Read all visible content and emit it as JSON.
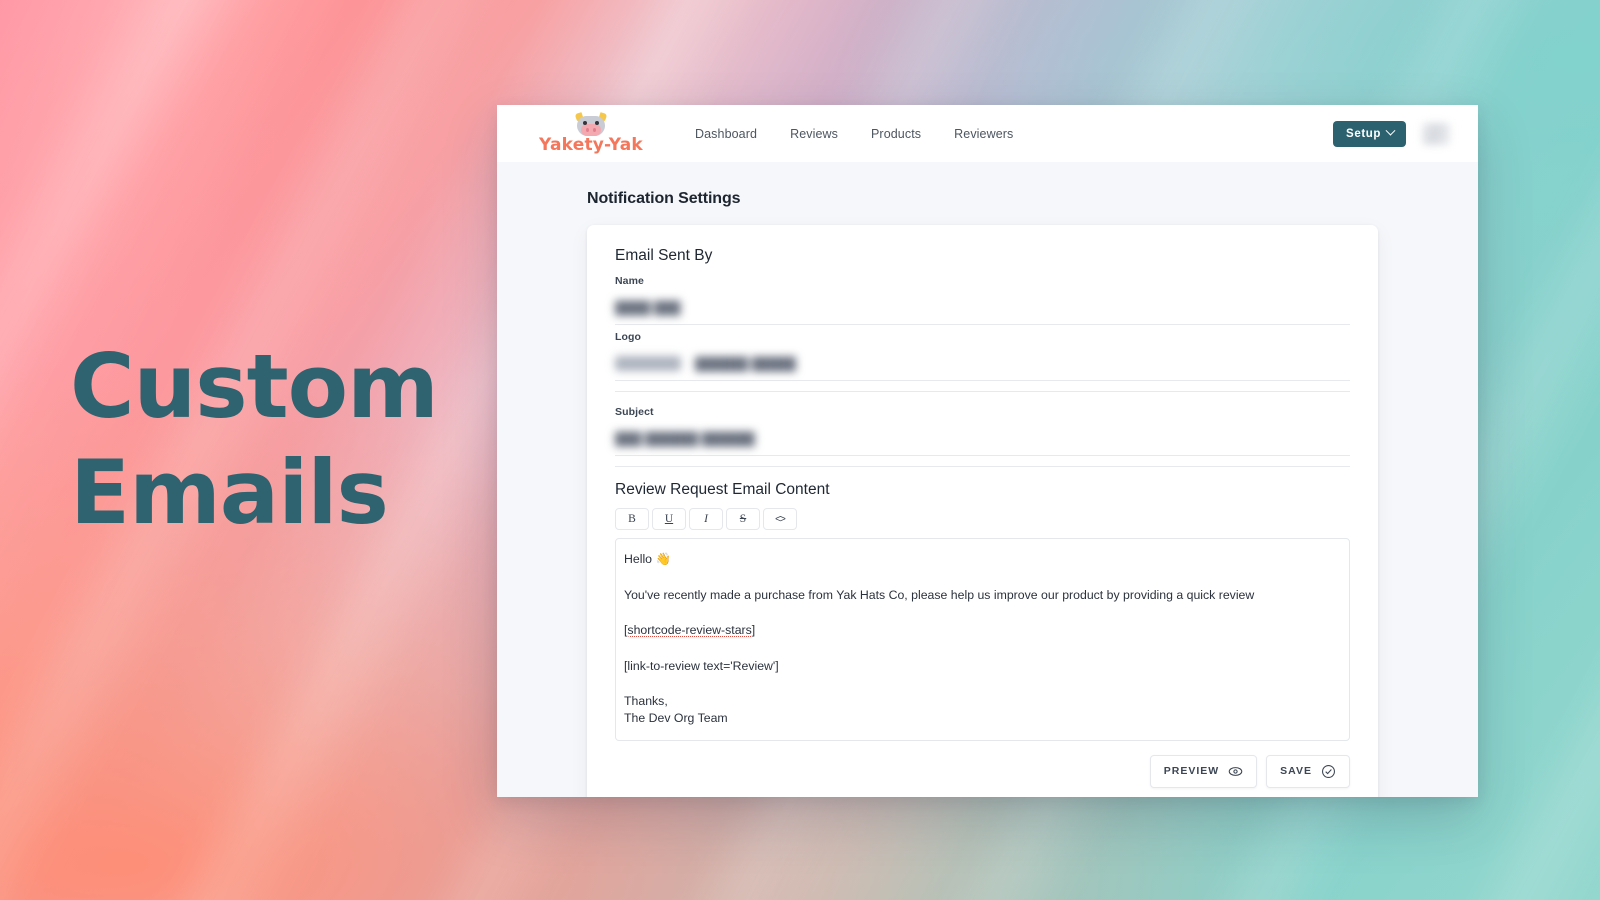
{
  "poster": {
    "headline": "Custom\nEmails",
    "headline_color": "#2e636f",
    "background_colors": [
      "#ff99a6",
      "#ff8f83",
      "#c3b9d4",
      "#8cd0cb",
      "#fb9181"
    ]
  },
  "app": {
    "brand": {
      "name": "Yakety-Yak",
      "name_color": "#f4775c",
      "logo_icon": "yak-face-icon"
    },
    "nav": [
      {
        "label": "Dashboard"
      },
      {
        "label": "Reviews"
      },
      {
        "label": "Products"
      },
      {
        "label": "Reviewers"
      }
    ],
    "header_actions": {
      "setup_label": "Setup",
      "setup_color": "#2c6270",
      "setup_chevron_icon": "chevron-down-icon",
      "avatar_icon": "avatar-blurred"
    },
    "page_title": "Notification Settings",
    "email_sent_by": {
      "section_title": "Email Sent By",
      "fields": [
        {
          "label": "Name",
          "value": "████ ███",
          "redacted": true
        },
        {
          "label": "Logo",
          "value": "██████ █████",
          "redacted": true
        },
        {
          "label": "Subject",
          "value": "███ ██████ ██████",
          "redacted": true
        }
      ]
    },
    "editor": {
      "title": "Review Request Email Content",
      "toolbar": [
        {
          "label": "B",
          "name": "bold-button"
        },
        {
          "label": "U",
          "name": "underline-button"
        },
        {
          "label": "I",
          "name": "italic-button"
        },
        {
          "label": "S",
          "name": "strikethrough-button"
        },
        {
          "label": "<>",
          "name": "code-button"
        }
      ],
      "body": {
        "greeting": "Hello 👋",
        "intro": "You've recently made a purchase from Yak Hats Co, please help us improve our product by providing a quick review",
        "shortcode_stars": "[shortcode-review-stars]",
        "shortcode_link": "[link-to-review text='Review']",
        "signoff_line1": "Thanks,",
        "signoff_line2": "The Dev Org Team"
      }
    },
    "actions": [
      {
        "label": "PREVIEW",
        "icon": "eye-icon"
      },
      {
        "label": "SAVE",
        "icon": "check-circle-icon"
      }
    ]
  }
}
